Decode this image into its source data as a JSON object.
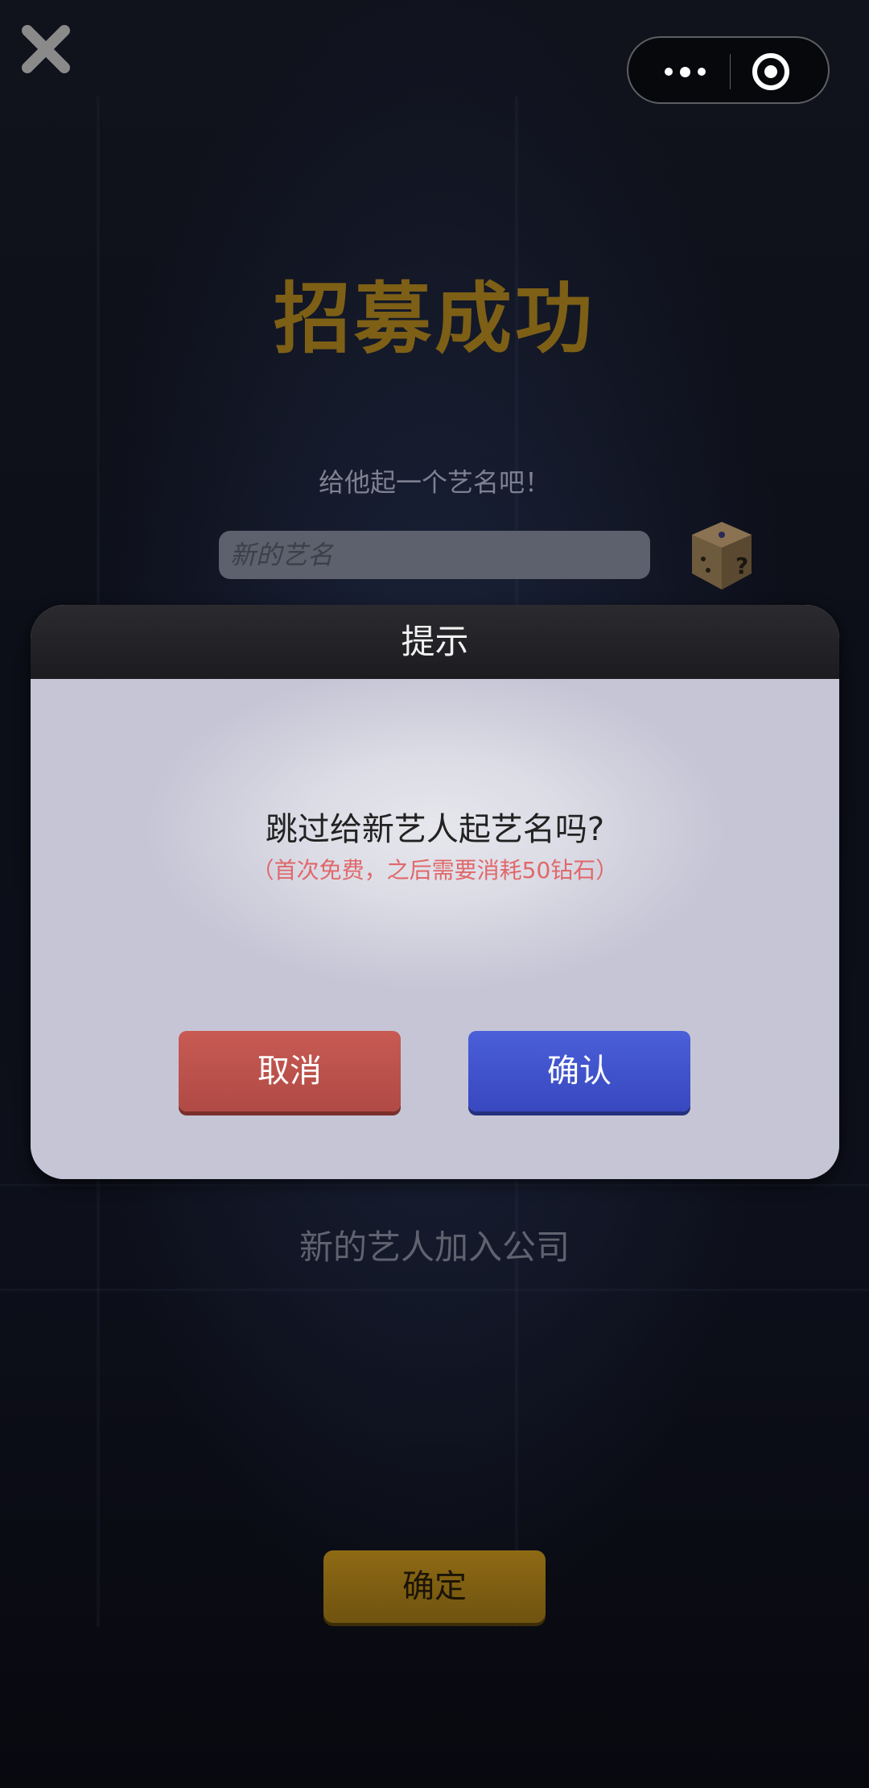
{
  "top_bar": {
    "close_icon": "close-x-icon",
    "more_icon": "more-dots-icon",
    "target_icon": "target-icon"
  },
  "page": {
    "title": "招募成功",
    "subtitle": "给他起一个艺名吧！",
    "name_placeholder": "新的艺名",
    "dice_icon": "dice-question-icon",
    "join_text": "新的艺人加入公司",
    "confirm_label": "确定"
  },
  "dialog": {
    "title": "提示",
    "question": "跳过给新艺人起艺名吗?",
    "note": "（首次免费，之后需要消耗50钻石）",
    "cancel_label": "取消",
    "ok_label": "确认"
  },
  "colors": {
    "title_gold": "#7d5f16",
    "cancel_red": "#c85a53",
    "ok_blue": "#4a5fd8",
    "note_red": "#e0686a"
  }
}
